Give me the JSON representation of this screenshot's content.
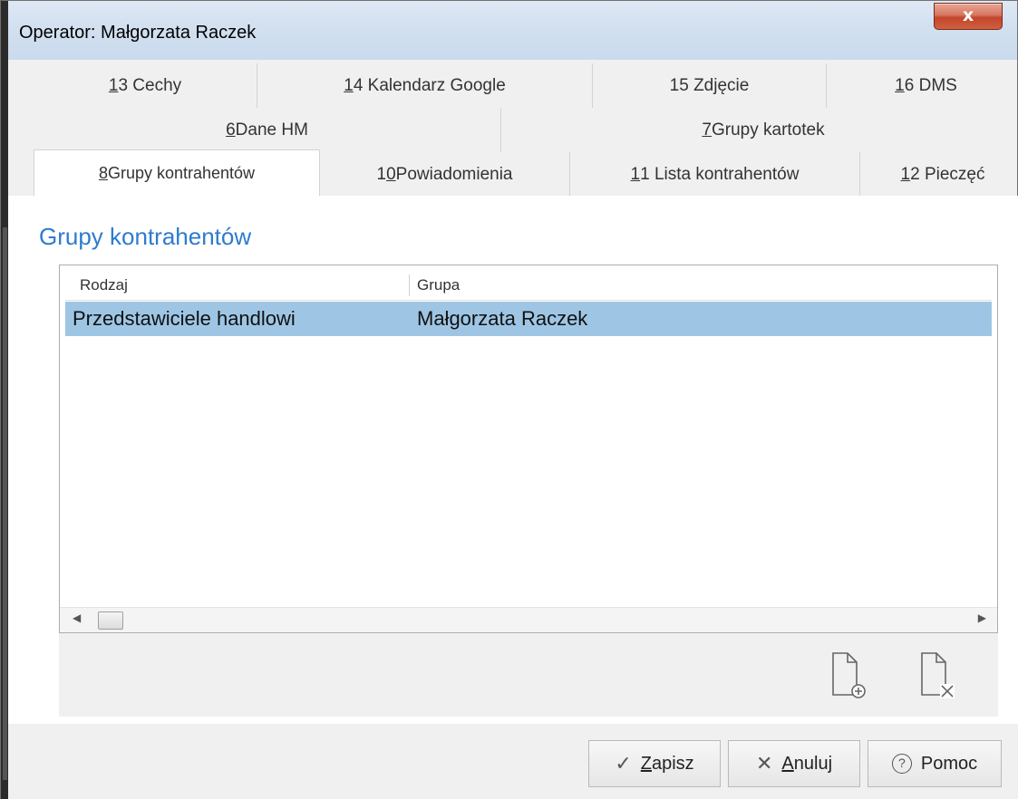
{
  "window": {
    "title": "Operator: Małgorzata Raczek",
    "close_label": "x"
  },
  "tabs": {
    "row1": [
      {
        "key": "1",
        "pre": "",
        "rest": "3 Cechy"
      },
      {
        "key": "1",
        "pre": "",
        "rest": "4 Kalendarz Google"
      },
      {
        "key": "",
        "pre": "15 Zdjęcie",
        "rest": ""
      },
      {
        "key": "1",
        "pre": "",
        "rest": "6 DMS"
      }
    ],
    "row2": [
      {
        "key": "6",
        "pre": "",
        "rest": " Dane HM"
      },
      {
        "key": "7",
        "pre": "",
        "rest": " Grupy kartotek"
      }
    ],
    "row3": [
      {
        "key": "8",
        "pre": "",
        "rest": " Grupy kontrahentów",
        "active": true
      },
      {
        "key": "0",
        "pre": "1",
        "rest": " Powiadomienia"
      },
      {
        "key": "1",
        "pre": "",
        "rest": "1 Lista kontrahentów"
      },
      {
        "key": "1",
        "pre": "",
        "rest": "2 Pieczęć"
      }
    ]
  },
  "section": {
    "title": "Grupy kontrahentów"
  },
  "grid": {
    "columns": [
      "Rodzaj",
      "Grupa"
    ],
    "rows": [
      {
        "rodzaj": "Przedstawiciele handlowi",
        "grupa": "Małgorzata Raczek"
      }
    ]
  },
  "toolbar": {
    "add_icon": "add-document-icon",
    "delete_icon": "delete-document-icon"
  },
  "footer": {
    "save": {
      "key": "Z",
      "rest": "apisz"
    },
    "cancel": {
      "key": "A",
      "rest": "nuluj"
    },
    "help": "Pomoc"
  }
}
